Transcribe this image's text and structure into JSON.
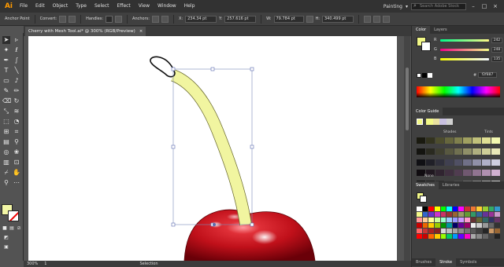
{
  "app": {
    "logo": "Ai",
    "menu": [
      "File",
      "Edit",
      "Object",
      "Type",
      "Select",
      "Effect",
      "View",
      "Window",
      "Help"
    ],
    "workspace": "Painting",
    "search_placeholder": "Search Adobe Stock"
  },
  "control_bar": {
    "tool_name": "Anchor Point",
    "convert_label": "Convert:",
    "handles_label": "Handles:",
    "anchors_label": "Anchors:",
    "x_label": "X:",
    "x_value": "234.34 pt",
    "y_label": "Y:",
    "y_value": "257.616 pt",
    "w_label": "W:",
    "w_value": "79.784 pt",
    "h_label": "H:",
    "h_value": "340.499 pt"
  },
  "document": {
    "tab_title": "Cherry with Mesh Tool.ai* @ 300% (RGB/Preview)",
    "close_glyph": "×"
  },
  "status": {
    "zoom": "300%",
    "page": "1",
    "tool": "Selection"
  },
  "colors": {
    "stem": "#f1f5a0",
    "cherry": "#c8141e",
    "fill": "#f3f7a6"
  },
  "color_panel": {
    "tabs": [
      "Color",
      "Color Guide"
    ],
    "active_tab": "Color",
    "sliders": [
      {
        "letter": "R",
        "value": "242"
      },
      {
        "letter": "G",
        "value": "248"
      },
      {
        "letter": "B",
        "value": "135"
      }
    ],
    "hex": "f2f887"
  },
  "color_guide": {
    "title": "Color Guide",
    "shades_label": "Shades",
    "tints_label": "Tints",
    "none_label": "None"
  },
  "swatches_panel": {
    "tabs": [
      "Swatches",
      "Libraries"
    ],
    "bottom_tabs": [
      "Brushes",
      "Stroke",
      "Symbols"
    ]
  },
  "tools": [
    "selection-tool",
    "direct-selection-tool",
    "magic-wand-tool",
    "lasso-tool",
    "pen-tool",
    "curvature-tool",
    "type-tool",
    "line-tool",
    "rectangle-tool",
    "paintbrush-tool",
    "shaper-tool",
    "pencil-tool",
    "eraser-tool",
    "rotate-tool",
    "scale-tool",
    "width-tool",
    "free-transform-tool",
    "shape-builder-tool",
    "perspective-grid-tool",
    "mesh-tool",
    "gradient-tool",
    "eyedropper-tool",
    "blend-tool",
    "symbol-sprayer-tool",
    "column-graph-tool",
    "artboard-tool",
    "slice-tool",
    "hand-tool",
    "zoom-tool"
  ]
}
